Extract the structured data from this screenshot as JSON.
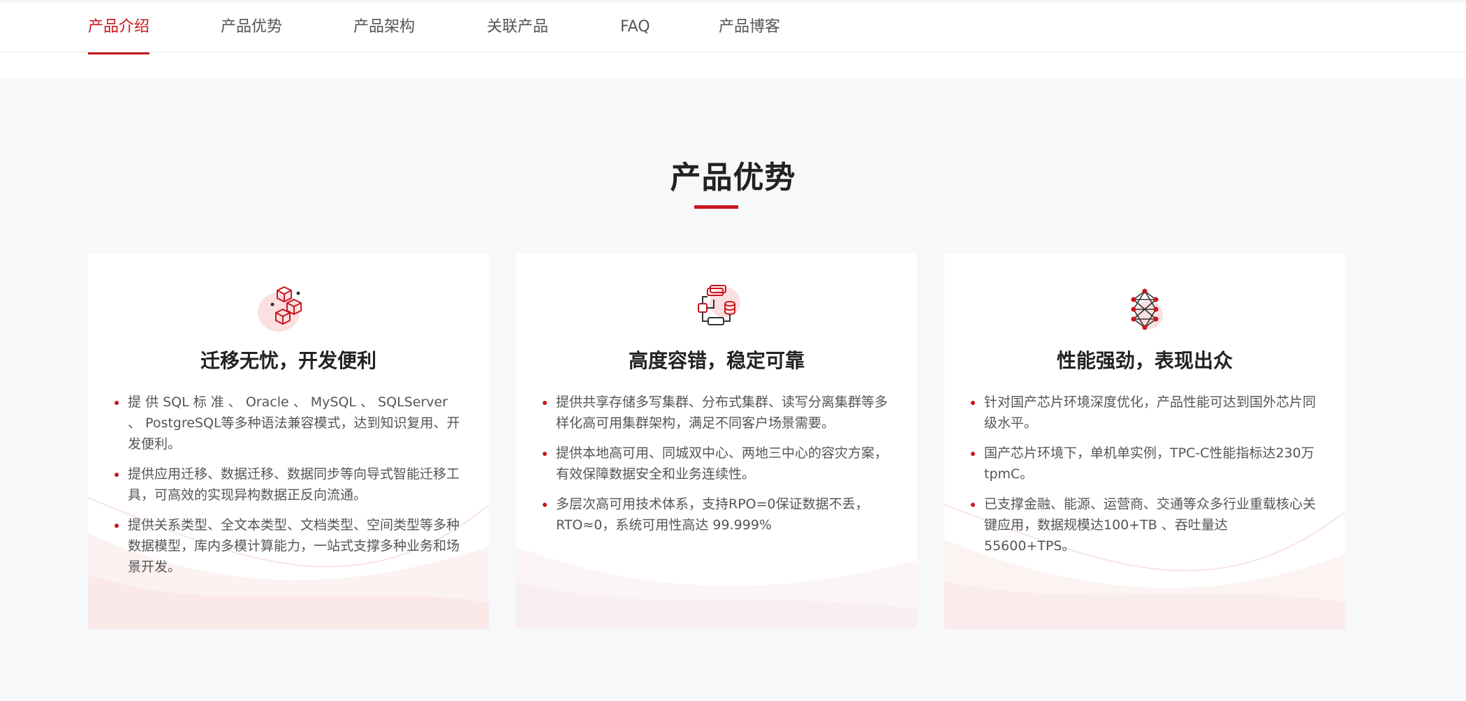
{
  "tabs": [
    {
      "label": "产品介绍",
      "active": true
    },
    {
      "label": "产品优势",
      "active": false
    },
    {
      "label": "产品架构",
      "active": false
    },
    {
      "label": "关联产品",
      "active": false
    },
    {
      "label": "FAQ",
      "active": false
    },
    {
      "label": "产品博客",
      "active": false
    }
  ],
  "section": {
    "title": "产品优势",
    "accent_color": "#c8161d"
  },
  "cards": [
    {
      "icon": "cubes-migration-icon",
      "title": "迁移无忧，开发便利",
      "items": [
        "提 供 SQL 标 准 、 Oracle 、 MySQL 、 SQLServer 、 PostgreSQL等多种语法兼容模式，达到知识复用、开发便利。",
        "提供应用迁移、数据迁移、数据同步等向导式智能迁移工具，可高效的实现异构数据正反向流通。",
        "提供关系类型、全文本类型、文档类型、空间类型等多种数据模型，库内多模计算能力，一站式支撑多种业务和场景开发。"
      ]
    },
    {
      "icon": "cluster-database-icon",
      "title": "高度容错，稳定可靠",
      "items": [
        "提供共享存储多写集群、分布式集群、读写分离集群等多样化高可用集群架构，满足不同客户场景需要。",
        "提供本地高可用、同城双中心、两地三中心的容灾方案，有效保障数据安全和业务连续性。",
        "多层次高可用技术体系，支持RPO=0保证数据不丢，RTO≈0，系统可用性高达 99.999%"
      ]
    },
    {
      "icon": "neural-network-icon",
      "title": "性能强劲，表现出众",
      "items": [
        "针对国产芯片环境深度优化，产品性能可达到国外芯片同级水平。",
        "国产芯片环境下，单机单实例，TPC-C性能指标达230万tpmC。",
        "已支撑金融、能源、运营商、交通等众多行业重载核心关键应用，数据规模达100+TB 、吞吐量达 55600+TPS。"
      ]
    }
  ]
}
